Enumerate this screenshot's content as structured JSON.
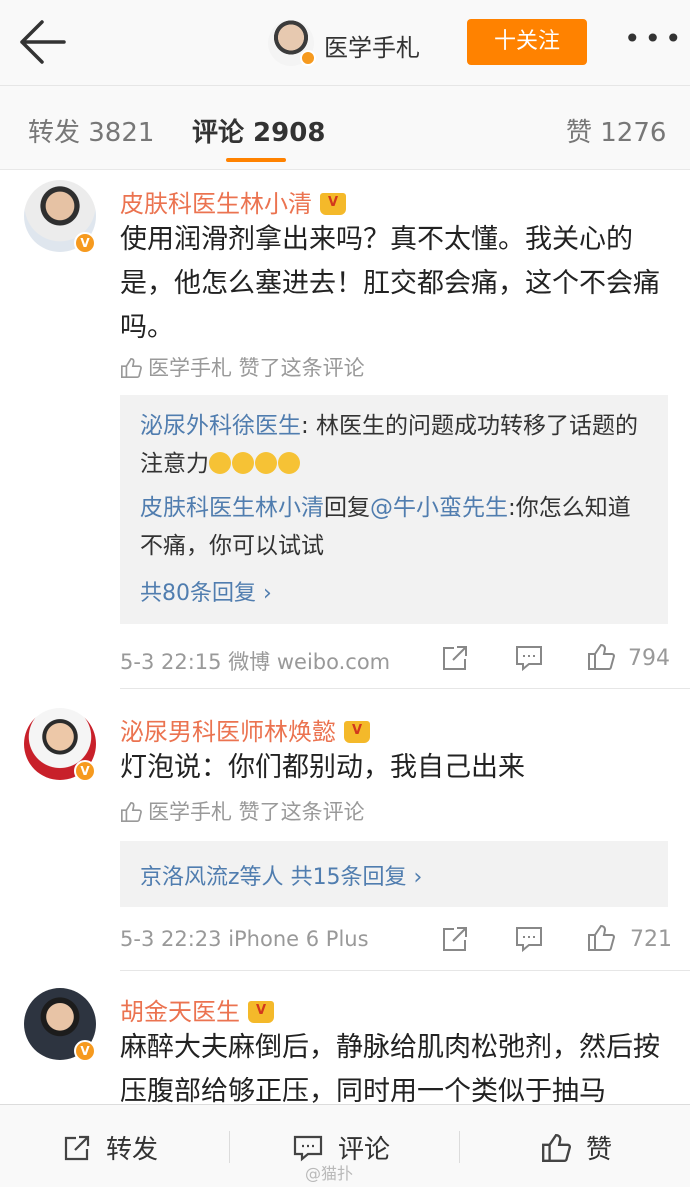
{
  "header": {
    "back_icon": "back-arrow-icon",
    "account_name": "医学手札",
    "follow_label": "十关注",
    "more_label": "•••"
  },
  "tabs": [
    {
      "label": "转发 3821"
    },
    {
      "label": "评论 2908"
    },
    {
      "label": "赞 1276"
    }
  ],
  "comments": [
    {
      "author": "皮肤科医生林小清",
      "text": "使用润滑剂拿出来吗？真不太懂。我关心的是，他怎么塞进去！肛交都会痛，这个不会痛吗。",
      "liked_by": "医学手札 赞了这条评论",
      "replies": [
        {
          "name": "泌尿外科徐医生",
          "text": ": 林医生的问题成功转移了话题的注意力"
        },
        {
          "name": "皮肤科医生林小清",
          "mid": "回复",
          "at": "@牛小蛮先生",
          "text": ":你怎么知道不痛，你可以试试"
        }
      ],
      "reply_more": "共80条回复 ›",
      "time": "5-3 22:15",
      "source": "微博 weibo.com",
      "likes": "794"
    },
    {
      "author": "泌尿男科医师林焕懿",
      "text": "灯泡说：你们都别动，我自己出来",
      "liked_by": "医学手札 赞了这条评论",
      "reply_summary_name": "京洛风流z等人",
      "reply_summary_count": "共15条回复 ›",
      "time": "5-3 22:23",
      "source": "iPhone 6 Plus",
      "likes": "721"
    },
    {
      "author": "胡金天医生",
      "text": "麻醉大夫麻倒后，静脉给肌肉松弛剂，然后按压腹部给够正压，同时用一个类似于抽马"
    }
  ],
  "bottom_bar": {
    "repost": "转发",
    "comment": "评论",
    "like": "赞"
  },
  "watermark": "@猫扑",
  "colors": {
    "accent": "#ff8200",
    "name": "#eb7350",
    "link": "#507daf"
  }
}
